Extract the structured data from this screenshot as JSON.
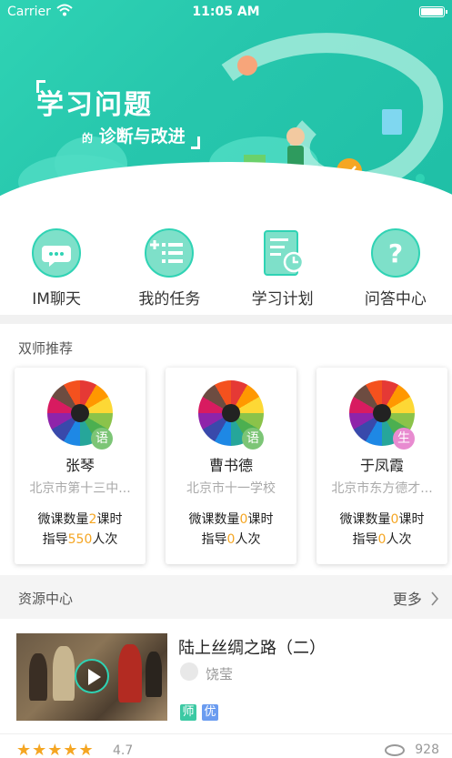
{
  "status_bar": {
    "carrier": "Carrier",
    "time": "11:05 AM"
  },
  "banner": {
    "title": "学习问题",
    "subtitle_prefix": "的",
    "subtitle": "诊断与改进"
  },
  "menu": [
    {
      "label": "IM聊天",
      "icon": "chat-icon"
    },
    {
      "label": "我的任务",
      "icon": "task-list-icon"
    },
    {
      "label": "学习计划",
      "icon": "plan-document-icon"
    },
    {
      "label": "问答中心",
      "icon": "question-icon"
    }
  ],
  "teachers_section": {
    "title": "双师推荐"
  },
  "teachers": [
    {
      "name": "张琴",
      "subject": "语",
      "subject_color": "#7cc576",
      "school": "北京市第十三中...",
      "lesson_prefix": "微课数量",
      "lessons": "2",
      "lesson_suffix": "课时",
      "guide_prefix": "指导",
      "guides": "550",
      "guide_suffix": "人次"
    },
    {
      "name": "曹书德",
      "subject": "语",
      "subject_color": "#7cc576",
      "school": "北京市十一学校",
      "lesson_prefix": "微课数量",
      "lessons": "0",
      "lesson_suffix": "课时",
      "guide_prefix": "指导",
      "guides": "0",
      "guide_suffix": "人次"
    },
    {
      "name": "于凤霞",
      "subject": "生",
      "subject_color": "#e88bd0",
      "school": "北京市东方德才...",
      "lesson_prefix": "微课数量",
      "lessons": "0",
      "lesson_suffix": "课时",
      "guide_prefix": "指导",
      "guides": "0",
      "guide_suffix": "人次"
    }
  ],
  "resources": {
    "title": "资源中心",
    "more": "更多",
    "item": {
      "title": "陆上丝绸之路（二）",
      "author": "饶莹",
      "tags": [
        {
          "text": "师",
          "color": "#3cc9a3"
        },
        {
          "text": "优",
          "color": "#6b9cf0"
        }
      ],
      "rating": "4.7",
      "views": "928"
    }
  },
  "colors": {
    "accent": "#2fd3b4",
    "highlight": "#f5a623"
  }
}
